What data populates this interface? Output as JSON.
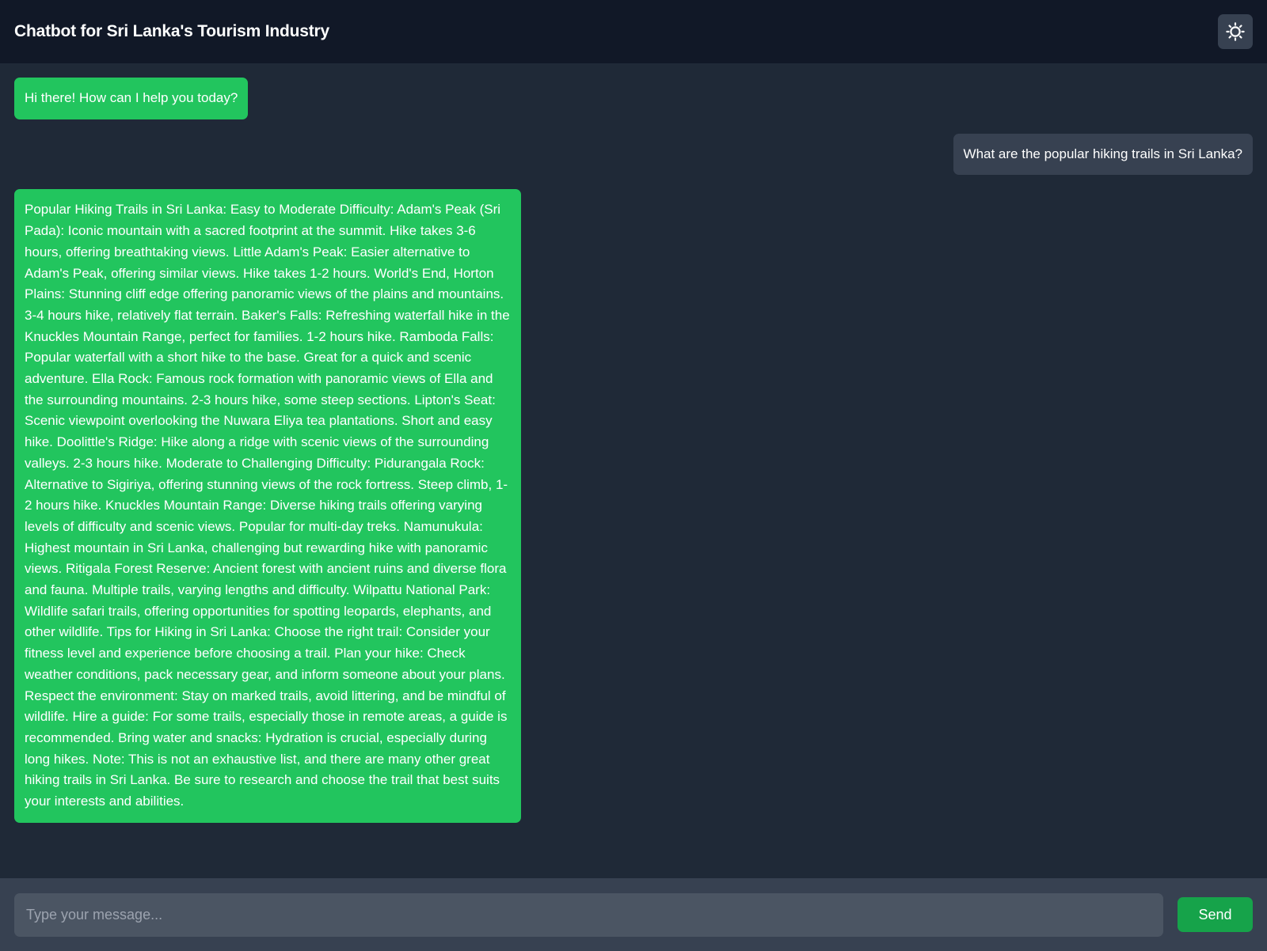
{
  "header": {
    "title": "Chatbot for Sri Lanka's Tourism Industry",
    "theme_toggle_icon": "sun-icon"
  },
  "messages": [
    {
      "sender": "bot",
      "text": "Hi there! How can I help you today?"
    },
    {
      "sender": "user",
      "text": "What are the popular hiking trails in Sri Lanka?"
    },
    {
      "sender": "bot",
      "text": "Popular Hiking Trails in Sri Lanka: Easy to Moderate Difficulty: Adam's Peak (Sri Pada): Iconic mountain with a sacred footprint at the summit. Hike takes 3-6 hours, offering breathtaking views. Little Adam's Peak: Easier alternative to Adam's Peak, offering similar views. Hike takes 1-2 hours. World's End, Horton Plains: Stunning cliff edge offering panoramic views of the plains and mountains. 3-4 hours hike, relatively flat terrain. Baker's Falls: Refreshing waterfall hike in the Knuckles Mountain Range, perfect for families. 1-2 hours hike. Ramboda Falls: Popular waterfall with a short hike to the base. Great for a quick and scenic adventure. Ella Rock: Famous rock formation with panoramic views of Ella and the surrounding mountains. 2-3 hours hike, some steep sections. Lipton's Seat: Scenic viewpoint overlooking the Nuwara Eliya tea plantations. Short and easy hike. Doolittle's Ridge: Hike along a ridge with scenic views of the surrounding valleys. 2-3 hours hike. Moderate to Challenging Difficulty: Pidurangala Rock: Alternative to Sigiriya, offering stunning views of the rock fortress. Steep climb, 1-2 hours hike. Knuckles Mountain Range: Diverse hiking trails offering varying levels of difficulty and scenic views. Popular for multi-day treks. Namunukula: Highest mountain in Sri Lanka, challenging but rewarding hike with panoramic views. Ritigala Forest Reserve: Ancient forest with ancient ruins and diverse flora and fauna. Multiple trails, varying lengths and difficulty. Wilpattu National Park: Wildlife safari trails, offering opportunities for spotting leopards, elephants, and other wildlife. Tips for Hiking in Sri Lanka: Choose the right trail: Consider your fitness level and experience before choosing a trail. Plan your hike: Check weather conditions, pack necessary gear, and inform someone about your plans. Respect the environment: Stay on marked trails, avoid littering, and be mindful of wildlife. Hire a guide: For some trails, especially those in remote areas, a guide is recommended. Bring water and snacks: Hydration is crucial, especially during long hikes. Note: This is not an exhaustive list, and there are many other great hiking trails in Sri Lanka. Be sure to research and choose the trail that best suits your interests and abilities."
    }
  ],
  "composer": {
    "placeholder": "Type your message...",
    "value": "",
    "send_label": "Send"
  },
  "colors": {
    "header_bg": "#111827",
    "page_bg": "#1f2937",
    "bot_bubble": "#22c55e",
    "user_bubble": "#374151",
    "composer_bg": "#374151",
    "input_bg": "#4b5563",
    "send_button": "#16a34a"
  }
}
